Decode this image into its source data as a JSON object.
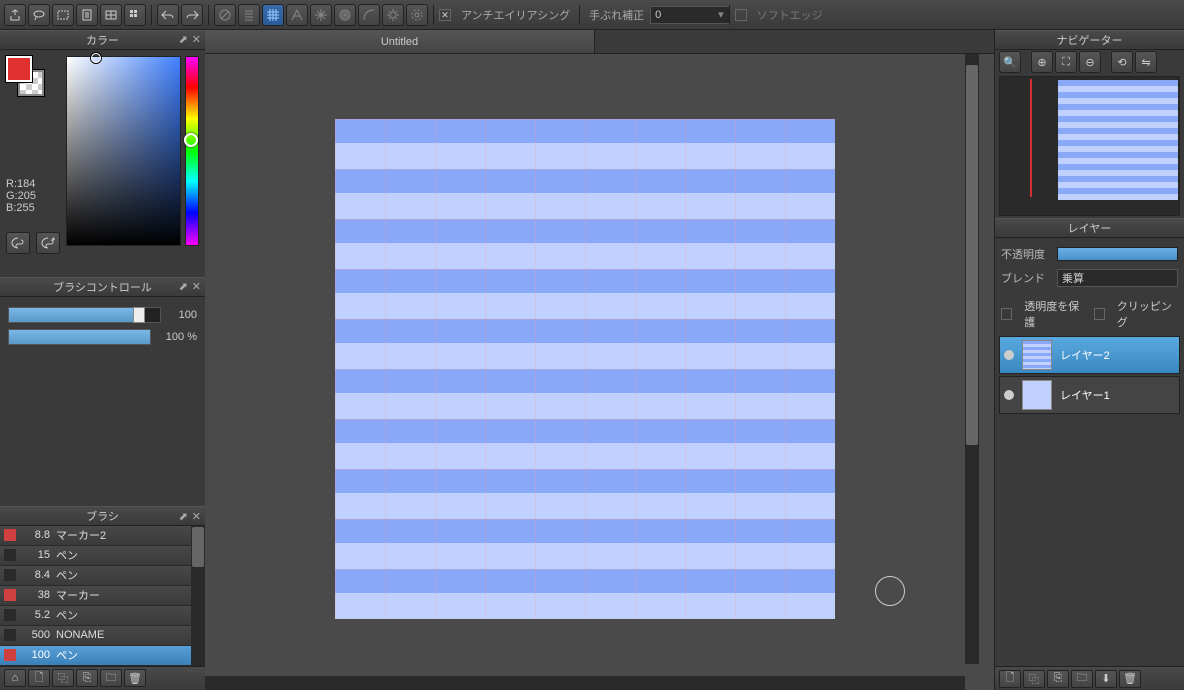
{
  "toolbar": {
    "antialiasing": "アンチエイリアシング",
    "stabilizer": "手ぶれ補正",
    "stabilizer_val": "0",
    "softedge": "ソフトエッジ"
  },
  "tab": {
    "title": "Untitled"
  },
  "panels": {
    "color": "カラー",
    "brush_control": "ブラシコントロール",
    "brush": "ブラシ",
    "navigator": "ナビゲーター",
    "layer": "レイヤー"
  },
  "color": {
    "r": "R:184",
    "g": "G:205",
    "b": "B:255"
  },
  "brush_control": {
    "val1": "100",
    "val2": "100 %"
  },
  "brushes": [
    {
      "size": "8.8",
      "name": "マーカー2",
      "red": true
    },
    {
      "size": "15",
      "name": "ペン",
      "red": false
    },
    {
      "size": "8.4",
      "name": "ペン",
      "red": false
    },
    {
      "size": "38",
      "name": "マーカー",
      "red": true
    },
    {
      "size": "5.2",
      "name": "ペン",
      "red": false
    },
    {
      "size": "500",
      "name": "NONAME",
      "red": false
    },
    {
      "size": "100",
      "name": "ペン",
      "red": true,
      "selected": true
    }
  ],
  "layer_opts": {
    "opacity": "不透明度",
    "blend": "ブレンド",
    "blend_mode": "乗算",
    "protect_alpha": "透明度を保護",
    "clipping": "クリッピング"
  },
  "layers": [
    {
      "name": "レイヤー2",
      "selected": true,
      "stripes": true
    },
    {
      "name": "レイヤー1",
      "selected": false,
      "stripes": false
    }
  ]
}
